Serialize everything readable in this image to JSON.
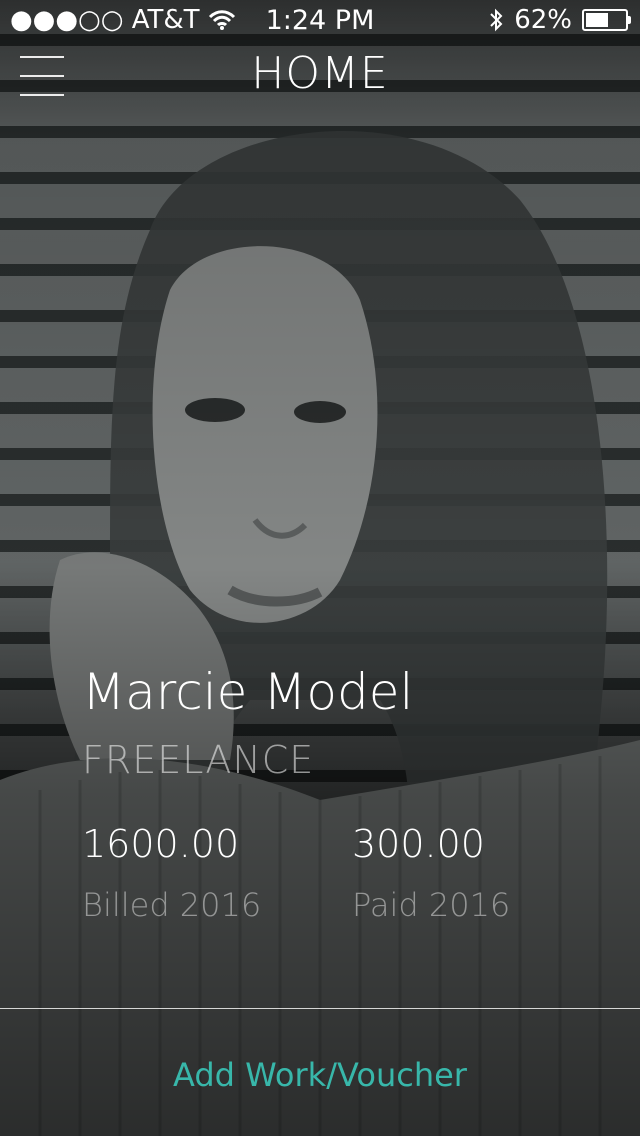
{
  "status_bar": {
    "carrier": "●●●○○ AT&T",
    "time": "1:24 PM",
    "battery_percent": "62%",
    "battery_level": 0.62
  },
  "nav": {
    "title": "HOME",
    "menu_icon": "hamburger-icon"
  },
  "profile": {
    "name": "Marcie Model",
    "role": "FREELANCE"
  },
  "stats": [
    {
      "value": "1600.00",
      "label": "Billed 2016"
    },
    {
      "value": "300.00",
      "label": "Paid 2016"
    }
  ],
  "actions": {
    "add_label": "Add Work/Voucher"
  },
  "colors": {
    "accent": "#38b7aa"
  }
}
